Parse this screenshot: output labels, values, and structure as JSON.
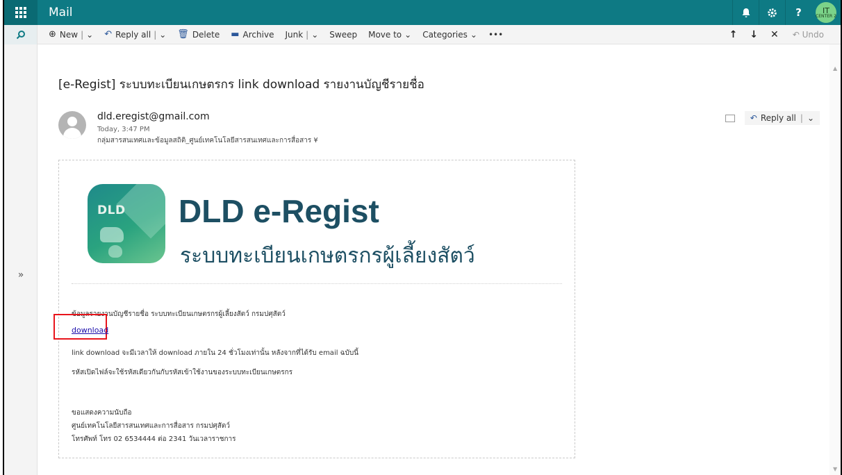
{
  "topbar": {
    "app_title": "Mail",
    "avatar_line1": "IT",
    "avatar_line2": "CENTER 2",
    "icons": [
      "bell-icon",
      "gear-icon",
      "help-icon"
    ]
  },
  "commandbar": {
    "new": "New",
    "reply_all": "Reply all",
    "delete": "Delete",
    "archive": "Archive",
    "junk": "Junk",
    "sweep": "Sweep",
    "move_to": "Move to",
    "categories": "Categories",
    "more": "•••",
    "undo": "Undo"
  },
  "rail": {
    "expand": "»"
  },
  "message": {
    "subject": "[e-Regist] ระบบทะเบียนเกษตรกร link download รายงานบัญชีรายชื่อ",
    "sender_email": "dld.eregist@gmail.com",
    "time": "Today, 3:47 PM",
    "to": "กลุ่มสารสนเทศและข้อมูลสถิติ_ศูนย์เทคโนโลยีสารสนเทศและการสื่อสาร ¥",
    "reply_all": "Reply all"
  },
  "email_body": {
    "logo_text": "DLD",
    "brand_title": "DLD e-Regist",
    "brand_subtitle": "ระบบทะเบียนเกษตรกรผู้เลี้ยงสัตว์",
    "line1": "ข้อมูลรายงานบัญชีรายชื่อ ระบบทะเบียนเกษตรกรผู้เลี้ยงสัตว์ กรมปศุสัตว์",
    "download_link": "download",
    "line2": "link download จะมีเวลาให้ download ภายใน 24 ชั่วโมงเท่านั้น หลังจากที่ได้รับ email ฉบับนี้",
    "line3": "รหัสเปิดไฟล์จะใช้รหัสเดียวกันกับรหัสเข้าใช้งานของระบบทะเบียนเกษตรกร",
    "sign1": "ขอแสดงความนับถือ",
    "sign2": "ศูนย์เทคโนโลยีสารสนเทศและการสื่อสาร กรมปศุสัตว์",
    "sign3": "โทรศัพท์ โทร 02 6534444 ต่อ 2341 วันเวลาราชการ"
  },
  "colors": {
    "topbar": "#0e7a84",
    "brand": "#1d4f63",
    "highlight": "#e8141b",
    "link": "#1a0dab"
  }
}
